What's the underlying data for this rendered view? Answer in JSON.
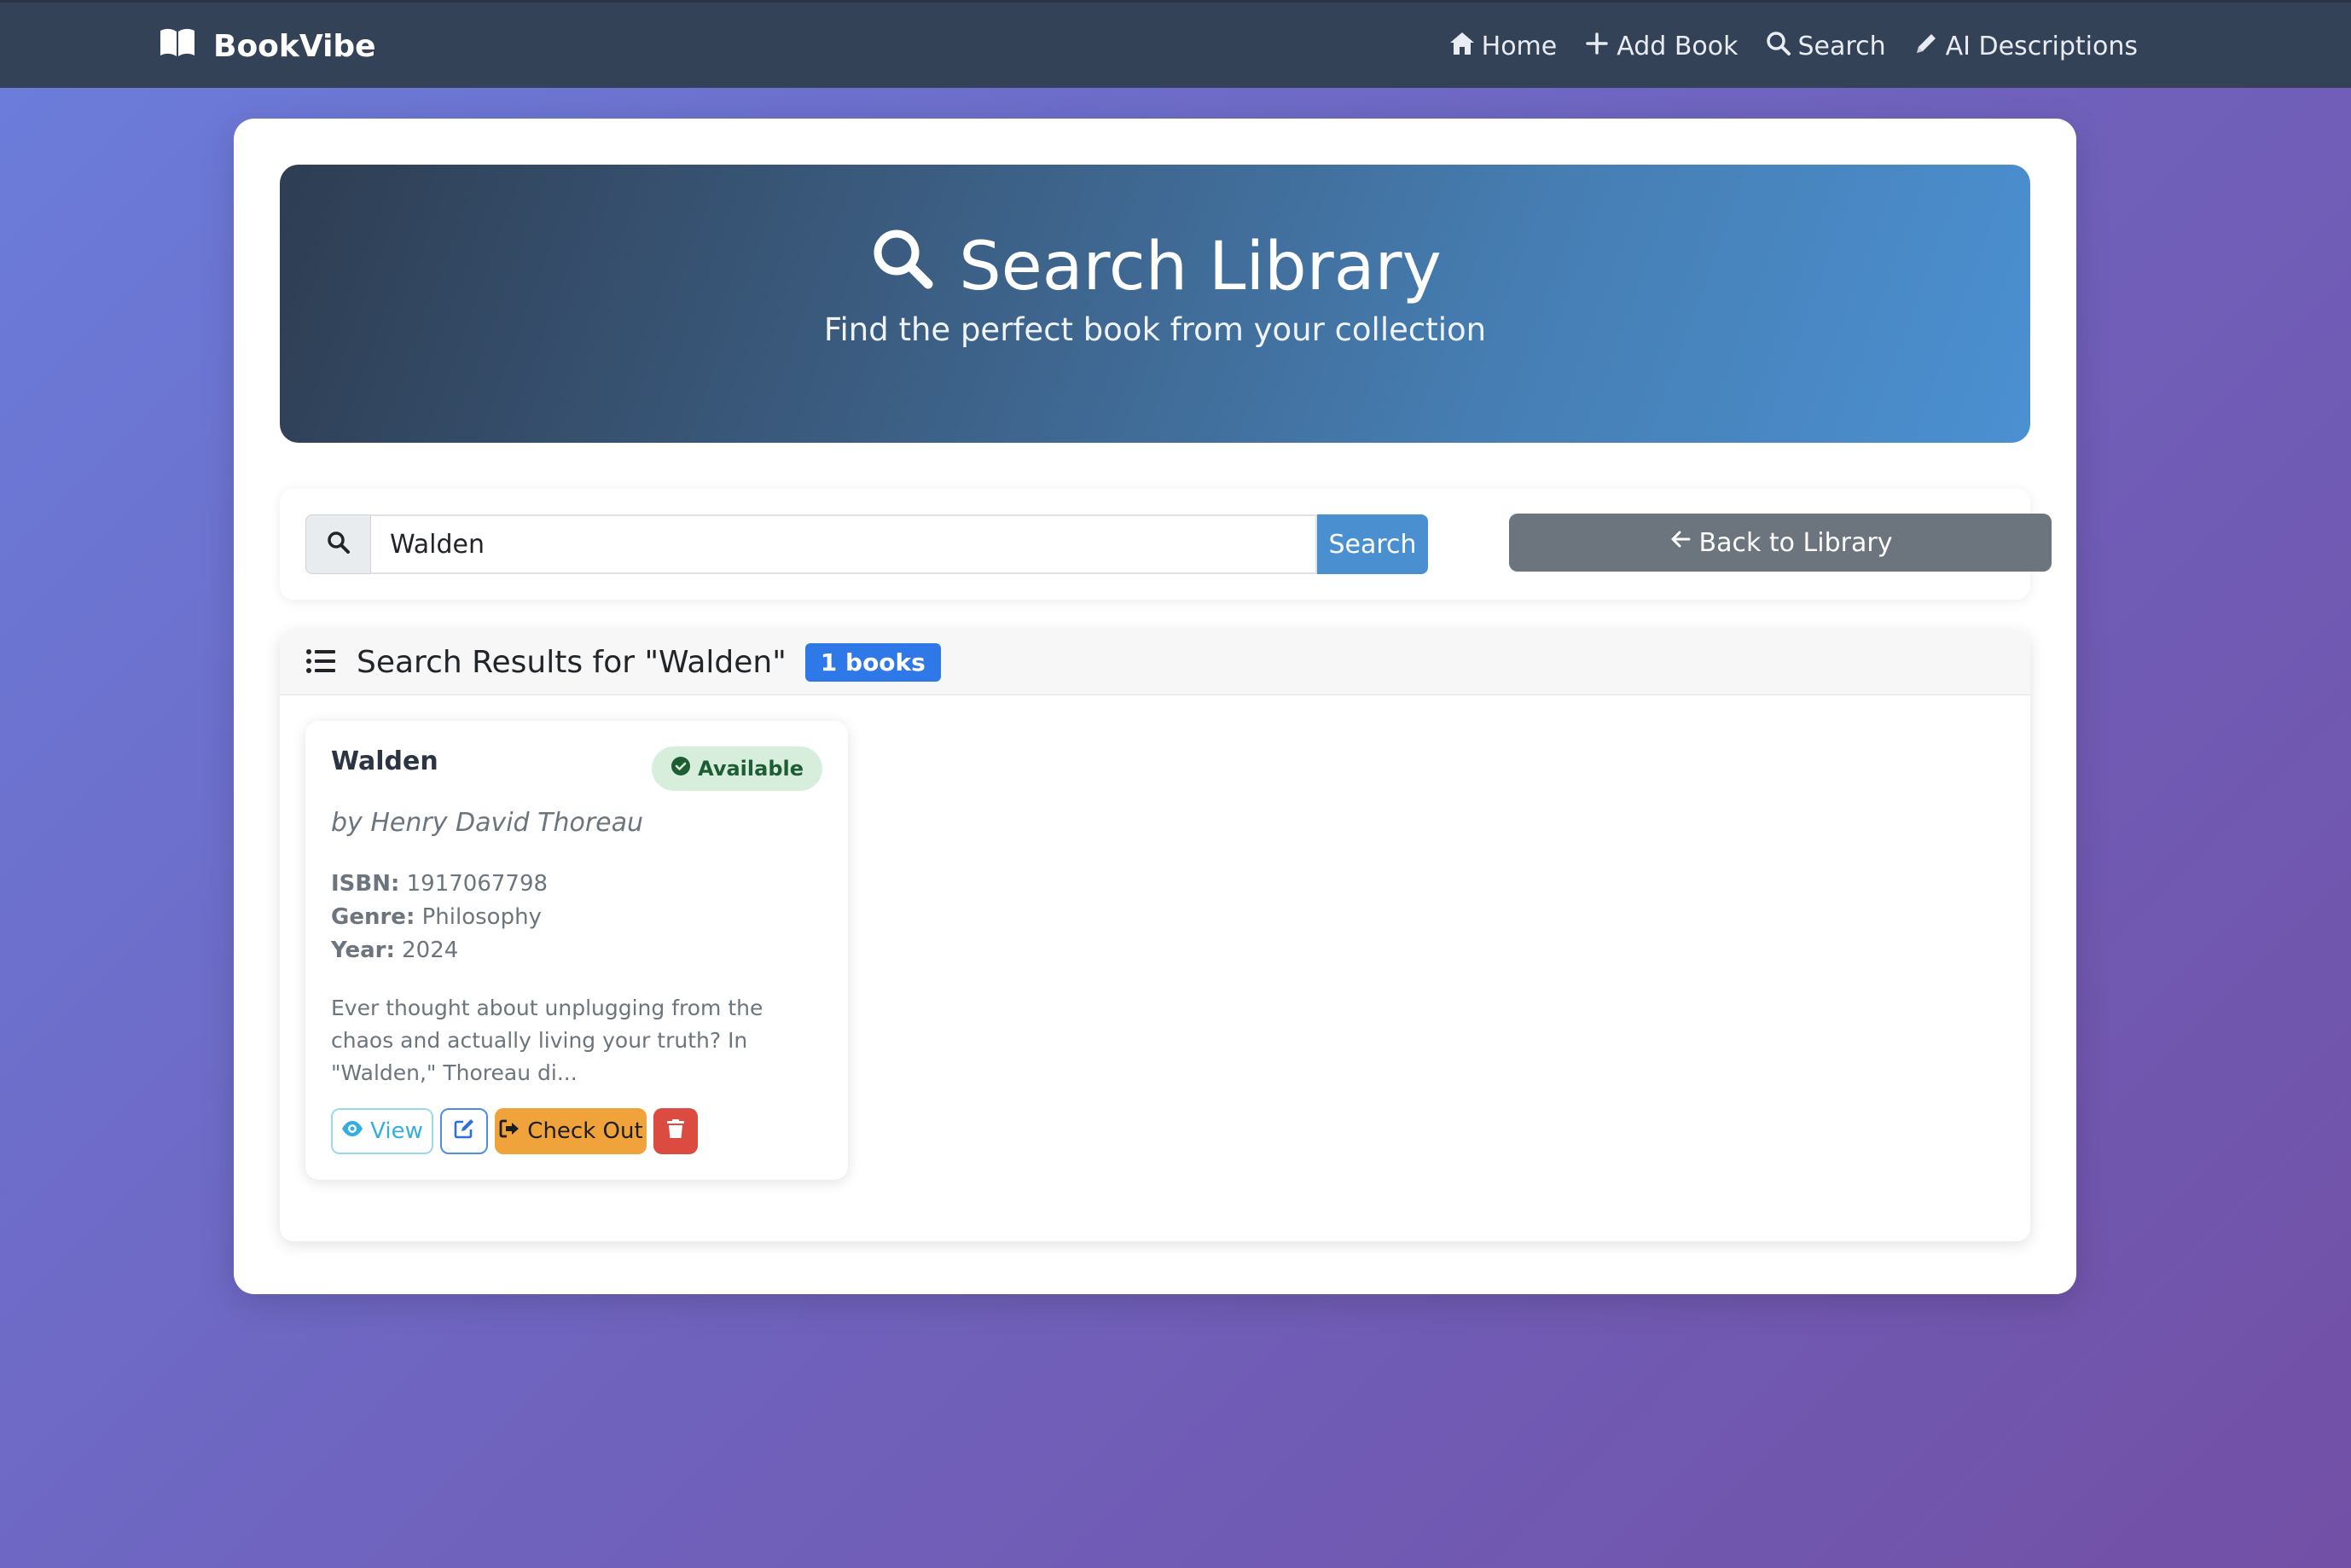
{
  "nav": {
    "brand": "BookVibe",
    "links": [
      {
        "label": "Home",
        "icon": "home-icon"
      },
      {
        "label": "Add Book",
        "icon": "plus-icon"
      },
      {
        "label": "Search",
        "icon": "search-icon"
      },
      {
        "label": "AI Descriptions",
        "icon": "pencil-icon"
      }
    ]
  },
  "hero": {
    "title": "Search Library",
    "subtitle": "Find the perfect book from your collection"
  },
  "search": {
    "value": "Walden",
    "button": "Search",
    "back": "Back to Library"
  },
  "results": {
    "title": "Search Results for \"Walden\"",
    "count": "1 books",
    "books": [
      {
        "title": "Walden",
        "status": "Available",
        "author": "by Henry David Thoreau",
        "isbn_label": "ISBN:",
        "isbn": "1917067798",
        "genre_label": "Genre:",
        "genre": "Philosophy",
        "year_label": "Year:",
        "year": "2024",
        "description": "Ever thought about unplugging from the chaos and actually living your truth? In \"Walden,\" Thoreau di...",
        "view_label": "View",
        "checkout_label": "Check Out"
      }
    ]
  },
  "colors": {
    "navbar": "#344258",
    "accent": "#2f78e8",
    "available": "#d7eedd",
    "checkout": "#f0a33a",
    "delete": "#dc4b40"
  }
}
